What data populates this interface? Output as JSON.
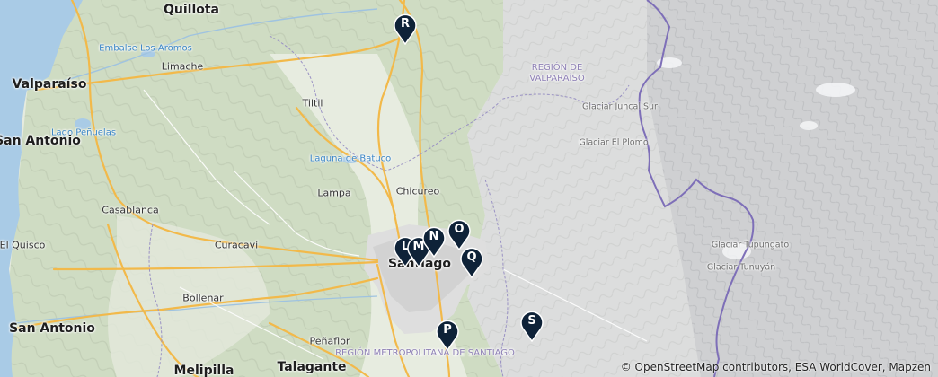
{
  "map": {
    "labels": {
      "quillota": "Quillota",
      "valparaiso": "Valparaíso",
      "embalse": "Embalse Los Aromos",
      "limache": "Limache",
      "region_valpo_1": "REGIÓN DE",
      "region_valpo_2": "VALPARAÍSO",
      "glaciar_juncal": "Glaciar Juncal Sur",
      "tiltil": "Tiltil",
      "lago_penuelas": "Lago Peñuelas",
      "san_antonio_town": "San Antonio",
      "laguna_batuco": "Laguna de Batuco",
      "glaciar_plomo": "Glaciar El Plomo",
      "lampa": "Lampa",
      "chicureo": "Chicureo",
      "casablanca": "Casablanca",
      "el_quisco": "El Quisco",
      "curacavi": "Curacaví",
      "santiago": "Santiago",
      "glaciar_tupungato": "Glaciar Tupungato",
      "glaciar_tunuyan": "Glaciar Tunuyán",
      "bollenar": "Bollenar",
      "penaflor": "Peñaflor",
      "region_metro": "REGIÓN METROPOLITANA DE SANTIAGO",
      "melipilla": "Melipilla",
      "talagante": "Talagante"
    },
    "markers": [
      {
        "letter": "R"
      },
      {
        "letter": "O"
      },
      {
        "letter": "N"
      },
      {
        "letter": "M"
      },
      {
        "letter": "L"
      },
      {
        "letter": "Q"
      },
      {
        "letter": "P"
      },
      {
        "letter": "S"
      }
    ],
    "marker_color": "#0e2238",
    "attribution": "© OpenStreetMap contributors, ESA WorldCover, Mapzen"
  }
}
